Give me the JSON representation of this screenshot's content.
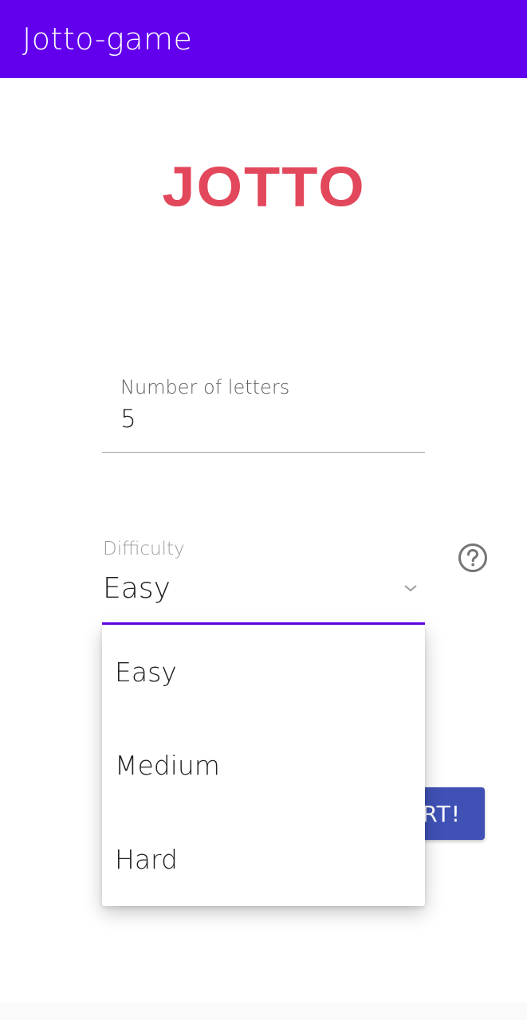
{
  "app_bar": {
    "title": "Jotto-game",
    "color": "#6200ee"
  },
  "logo": {
    "text": "JOTTO",
    "color": "#e2475b"
  },
  "letters_field": {
    "label": "Number of letters",
    "value": "5"
  },
  "difficulty_field": {
    "label": "Difficulty",
    "value": "Easy",
    "accent": "#6200ee"
  },
  "help": {
    "icon": "help-circle-icon"
  },
  "start_button": {
    "label_visible": "RT!",
    "color": "#3f51b5"
  },
  "dropdown": {
    "options": [
      "Easy",
      "Medium",
      "Hard"
    ]
  }
}
